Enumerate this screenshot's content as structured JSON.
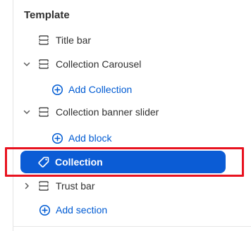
{
  "template": {
    "title": "Template",
    "sections": [
      {
        "label": "Title bar",
        "icon": "section-icon",
        "expandable": false
      },
      {
        "label": "Collection Carousel",
        "icon": "section-icon",
        "expandable": true
      },
      {
        "add_label": "Add Collection"
      },
      {
        "label": "Collection banner slider",
        "icon": "section-icon",
        "expandable": true
      },
      {
        "add_label": "Add block"
      },
      {
        "label": "Collection",
        "icon": "tag-icon",
        "selected": true
      },
      {
        "label": "Trust bar",
        "icon": "section-icon",
        "expandable": true,
        "collapsed": true
      },
      {
        "add_label": "Add section"
      }
    ]
  },
  "colors": {
    "accent": "#005bd3",
    "selected_bg": "#0b5cd5",
    "highlight": "#e8121f"
  }
}
